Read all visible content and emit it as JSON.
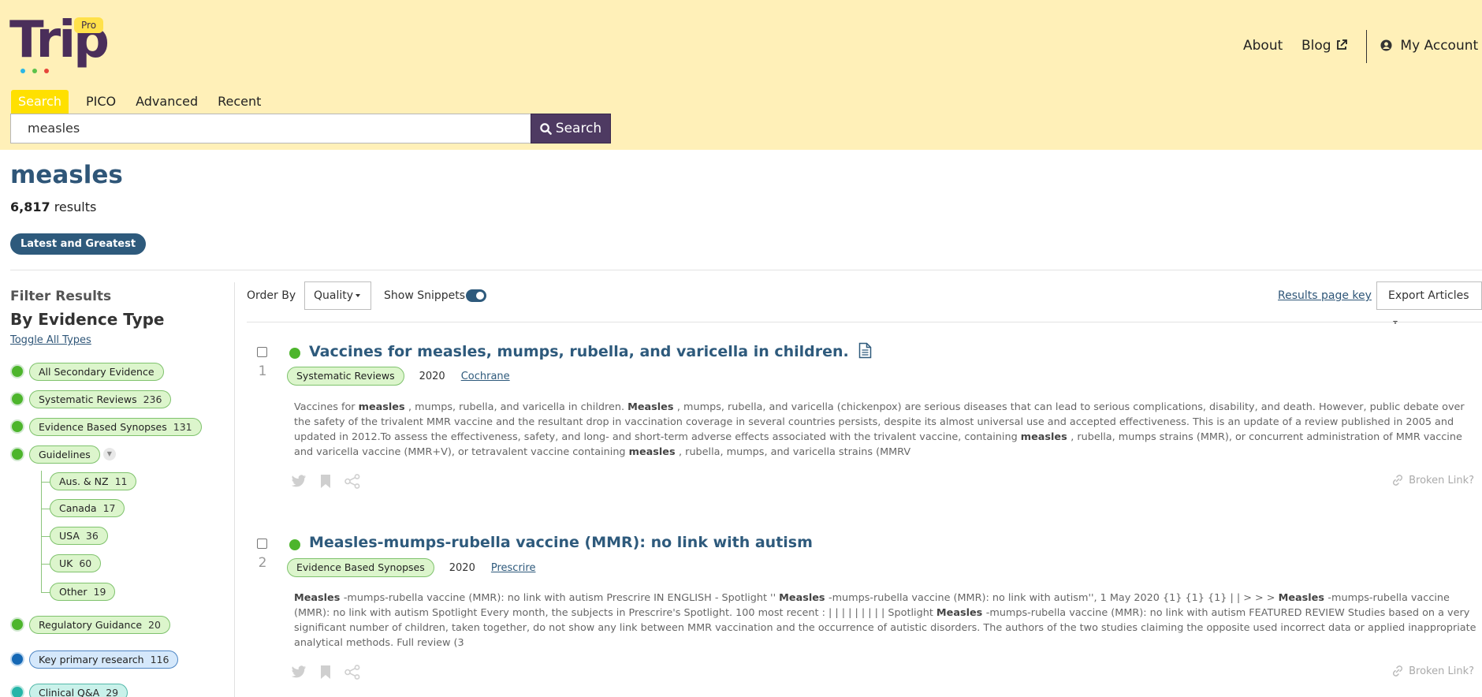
{
  "brand": {
    "logo_text": "Trip",
    "badge": "Pro",
    "accent": "#fff0b8",
    "primary": "#4e3a62",
    "link_color": "#2e5a7c"
  },
  "nav": {
    "about": "About",
    "blog": "Blog",
    "account": "My Account"
  },
  "search_tabs": [
    "Search",
    "PICO",
    "Advanced",
    "Recent"
  ],
  "search": {
    "value": "measles",
    "button_label": "Search"
  },
  "query": {
    "title": "measles",
    "count": "6,817",
    "count_suffix": " results",
    "latest_label": "Latest and Greatest"
  },
  "sidebar": {
    "filter_title": "Filter Results",
    "evidence_title": "By Evidence Type",
    "toggle_all": "Toggle All Types",
    "items": [
      {
        "label": "All Secondary Evidence",
        "count": ""
      },
      {
        "label": "Systematic Reviews",
        "count": "236"
      },
      {
        "label": "Evidence Based Synopses",
        "count": "131"
      },
      {
        "label": "Guidelines",
        "count": ""
      },
      {
        "label": "Regulatory Guidance",
        "count": "20"
      },
      {
        "label": "Key primary research",
        "count": "116"
      },
      {
        "label": "Clinical Q&A",
        "count": "29"
      }
    ],
    "guideline_subitems": [
      {
        "label": "Aus. & NZ",
        "count": "11"
      },
      {
        "label": "Canada",
        "count": "17"
      },
      {
        "label": "USA",
        "count": "36"
      },
      {
        "label": "UK",
        "count": "60"
      },
      {
        "label": "Other",
        "count": "19"
      }
    ]
  },
  "toolbar": {
    "order_by_label": "Order By",
    "order_value": "Quality",
    "show_snippets_label": "Show Snippets",
    "show_snippets_on": true,
    "page_key": "Results page key",
    "export": "Export Articles"
  },
  "results": [
    {
      "number": "1",
      "title": "Vaccines for measles, mumps, rubella, and varicella in children.",
      "type": "Systematic Reviews",
      "year": "2020",
      "source": "Cochrane",
      "snippet_parts": [
        "Vaccines for ",
        " measles ",
        ", mumps, rubella, and varicella in children. ",
        " Measles ",
        ", mumps, rubella, and varicella (chickenpox) are serious diseases that can lead to serious complications, disability, and death. However, public debate over the safety of the trivalent MMR vaccine and the resultant drop in vaccination coverage in several countries persists, despite its almost universal use and accepted effectiveness. This is an update of a review published in 2005 and updated in 2012.To assess the effectiveness, safety, and long- and short-term adverse effects associated with the trivalent vaccine, containing ",
        " measles ",
        ", rubella, mumps strains (MMR), or concurrent administration of MMR vaccine and varicella vaccine (MMR+V), or tetravalent vaccine containing ",
        " measles ",
        ", rubella, mumps, and varicella strains (MMRV"
      ],
      "broken_link": "Broken Link?"
    },
    {
      "number": "2",
      "title": "Measles-mumps-rubella vaccine (MMR): no link with autism",
      "type": "Evidence Based Synopses",
      "year": "2020",
      "source": "Prescrire",
      "snippet_parts": [
        "",
        " Measles ",
        "-mumps-rubella vaccine (MMR): no link with autism Prescrire IN ENGLISH - Spotlight '' ",
        "Measles ",
        "-mumps-rubella vaccine (MMR): no link with autism'', 1 May 2020 {1} {1} {1} | | > > > ",
        " Measles ",
        "-mumps-rubella vaccine (MMR): no link with autism Spotlight Every month, the subjects in Prescrire's Spotlight. 100 most recent : | | | | | | | | | Spotlight ",
        " Measles ",
        "-mumps-rubella vaccine (MMR): no link with autism FEATURED REVIEW Studies based on a very significant number of children, taken together, do not show any link between MMR vaccination and the occurrence of autistic disorders. The authors of the two studies claiming the opposite used incorrect data or applied inappropriate analytical methods. Full review (3"
      ],
      "broken_link": "Broken Link?"
    }
  ]
}
